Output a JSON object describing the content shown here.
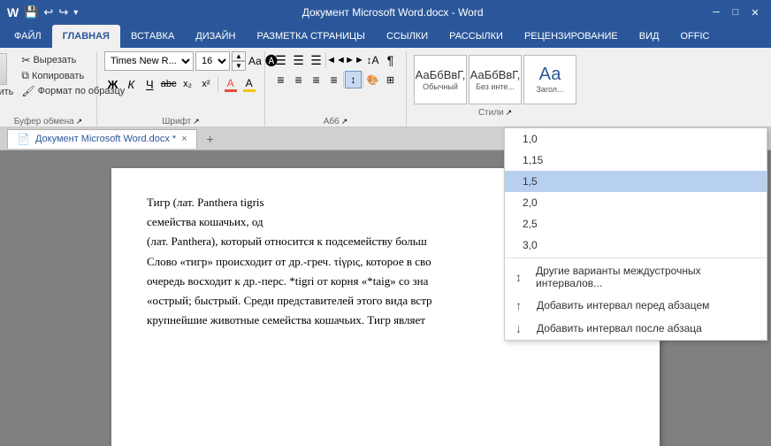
{
  "titlebar": {
    "title": "Документ Microsoft Word.docx - Word",
    "window_controls": [
      "─",
      "□",
      "✕"
    ]
  },
  "ribbon_tabs": [
    {
      "id": "file",
      "label": "ФАЙЛ"
    },
    {
      "id": "home",
      "label": "ГЛАВНАЯ",
      "active": true
    },
    {
      "id": "insert",
      "label": "ВСТАВКА"
    },
    {
      "id": "design",
      "label": "ДИЗАЙН"
    },
    {
      "id": "layout",
      "label": "РАЗМЕТКА СТРАНИЦЫ"
    },
    {
      "id": "references",
      "label": "ССЫЛКИ"
    },
    {
      "id": "mailings",
      "label": "РАССЫЛКИ"
    },
    {
      "id": "review",
      "label": "РЕЦЕНЗИРОВАНИЕ"
    },
    {
      "id": "view",
      "label": "ВИД"
    },
    {
      "id": "office",
      "label": "OFFIC"
    }
  ],
  "ribbon": {
    "groups": {
      "clipboard": {
        "label": "Буфер обмена",
        "paste_label": "Вставить",
        "buttons": [
          "Вырезать",
          "Копировать",
          "Формат по образцу"
        ]
      },
      "font": {
        "label": "Шрифт",
        "font_name": "Times New R...",
        "font_size": "16",
        "buttons": [
          "Ж",
          "К",
          "Ч",
          "abc",
          "x₂",
          "x²"
        ]
      },
      "paragraph": {
        "label": "Абз",
        "ab_label": "Аб6"
      },
      "styles": {
        "label": "",
        "items": [
          {
            "label": "Обычный",
            "preview": "АаБбВвГ,"
          },
          {
            "label": "Без инте...",
            "preview": "АаБбВвГ,"
          },
          {
            "label": "Загол...",
            "preview": "Аа"
          }
        ]
      }
    }
  },
  "doc_tab": {
    "title": "Документ Microsoft Word.docx *",
    "close": "×"
  },
  "document": {
    "text_lines": [
      "Тигр (лат. Panthera tigris",
      "семейства кошачьих, од",
      "(лат. Panthera), который относится к подсемейству больш",
      "Слово «тигр» происходит от др.-греч. τίγρις, которое в сво",
      "очередь восходит к др.-перс. *tigri от корня «*taig» со зна",
      "«острый; быстрый. Среди представителей этого вида встр",
      "крупнейшие животные семейства кошачьих. Тигр являет"
    ]
  },
  "line_spacing_dropdown": {
    "items": [
      {
        "value": "1,0",
        "selected": false
      },
      {
        "value": "1,15",
        "selected": false
      },
      {
        "value": "1,5",
        "selected": true
      },
      {
        "value": "2,0",
        "selected": false
      },
      {
        "value": "2,5",
        "selected": false
      },
      {
        "value": "3,0",
        "selected": false
      }
    ],
    "divider_after": 5,
    "actions": [
      {
        "icon": "↕",
        "label": "Другие варианты междустрочных интервалов..."
      },
      {
        "icon": "↑",
        "label": "Добавить интервал перед абзацем"
      },
      {
        "icon": "↓",
        "label": "Добавить интервал после абзаца"
      }
    ]
  },
  "icons": {
    "save": "💾",
    "undo": "↩",
    "redo": "↪",
    "cut": "✂",
    "copy": "⧉",
    "format_painter": "🖌",
    "bold": "Ж",
    "italic": "К",
    "underline": "Ч",
    "strikethrough": "abc",
    "subscript": "x₂",
    "superscript": "x²",
    "font_color": "А",
    "highlight": "🖍",
    "align_left": "≡",
    "align_center": "≡",
    "align_right": "≡",
    "justify": "≡",
    "line_spacing": "↕",
    "bullets": "☰",
    "numbering": "☰"
  }
}
